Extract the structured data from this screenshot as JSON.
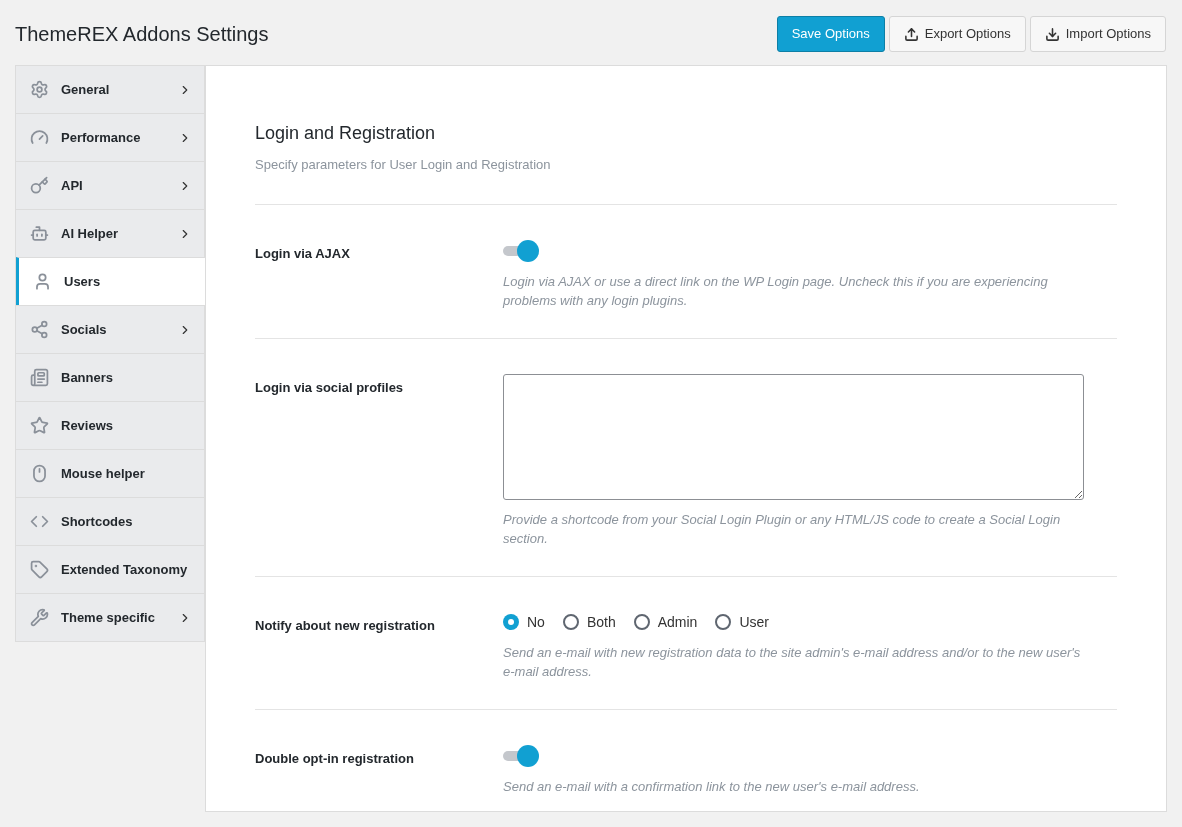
{
  "page_title": "ThemeREX Addons Settings",
  "actions": [
    {
      "label": "Save Options",
      "kind": "primary"
    },
    {
      "label": "Export Options",
      "kind": "export"
    },
    {
      "label": "Import Options",
      "kind": "import"
    }
  ],
  "sidebar": {
    "items": [
      {
        "label": "General",
        "selected": false,
        "has_submenu": true
      },
      {
        "label": "Performance",
        "selected": false,
        "has_submenu": true
      },
      {
        "label": "API",
        "selected": false,
        "has_submenu": true
      },
      {
        "label": "AI Helper",
        "selected": false,
        "has_submenu": true
      },
      {
        "label": "Users",
        "selected": true,
        "has_submenu": false
      },
      {
        "label": "Socials",
        "selected": false,
        "has_submenu": true
      },
      {
        "label": "Banners",
        "selected": false,
        "has_submenu": false
      },
      {
        "label": "Reviews",
        "selected": false,
        "has_submenu": false
      },
      {
        "label": "Mouse helper",
        "selected": false,
        "has_submenu": false
      },
      {
        "label": "Shortcodes",
        "selected": false,
        "has_submenu": false
      },
      {
        "label": "Extended Taxonomy",
        "selected": false,
        "has_submenu": false
      },
      {
        "label": "Theme specific",
        "selected": false,
        "has_submenu": true
      }
    ]
  },
  "section": {
    "title": "Login and Registration",
    "subtitle": "Specify parameters for User Login and Registration",
    "fields": [
      {
        "kind": "toggle",
        "label": "Login via AJAX",
        "on": true,
        "description": "Login via AJAX or use a direct link on the WP Login page. Uncheck this if you are experiencing problems with any login plugins."
      },
      {
        "kind": "textarea",
        "label": "Login via social profiles",
        "description": "Provide a shortcode from your Social Login Plugin or any HTML/JS code to create a Social Login section."
      },
      {
        "kind": "radio",
        "label": "Notify about new registration",
        "options": [
          {
            "label": "No",
            "selected": true
          },
          {
            "label": "Both",
            "selected": false
          },
          {
            "label": "Admin",
            "selected": false
          },
          {
            "label": "User",
            "selected": false
          }
        ],
        "description": "Send an e-mail with new registration data to the site admin's e-mail address and/or to the new user's e-mail address."
      },
      {
        "kind": "toggle",
        "label": "Double opt-in registration",
        "on": true,
        "description": "Send an e-mail with a confirmation link to the new user's e-mail address."
      }
    ]
  }
}
